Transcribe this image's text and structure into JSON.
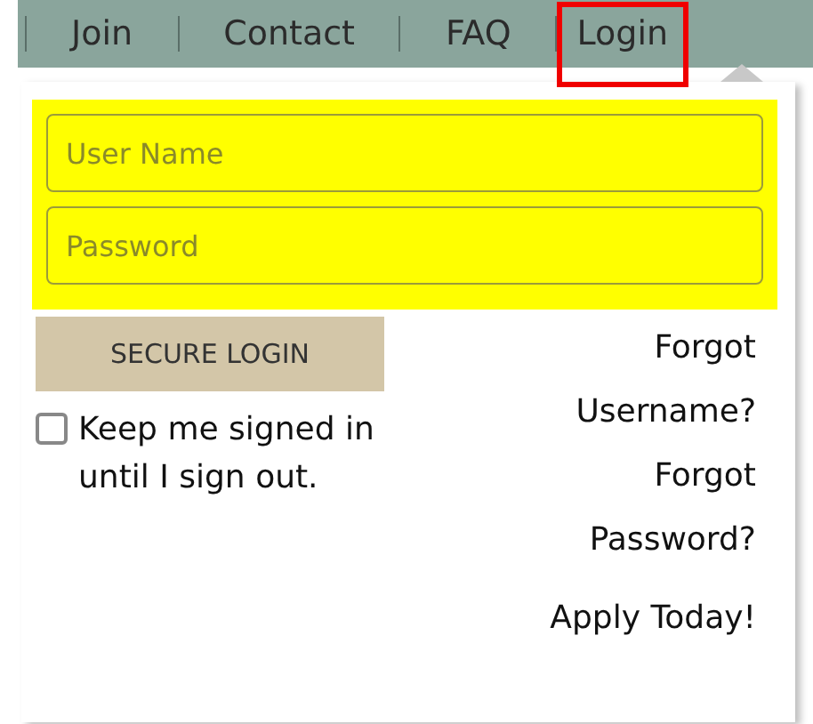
{
  "nav": [
    {
      "label": "Join",
      "highlighted": false
    },
    {
      "label": "Contact",
      "highlighted": false
    },
    {
      "label": "FAQ",
      "highlighted": false
    },
    {
      "label": "Login",
      "highlighted": true
    }
  ],
  "login_panel": {
    "fields_highlighted": true,
    "fields": [
      {
        "placeholder": "User Name"
      },
      {
        "placeholder": "Password"
      }
    ],
    "submit": "SECURE LOGIN",
    "remember": {
      "label": "Keep me signed in until I sign out.",
      "checked": false
    },
    "links": [
      "Forgot Username?",
      "Forgot Password?"
    ],
    "apply": "Apply Today!"
  }
}
